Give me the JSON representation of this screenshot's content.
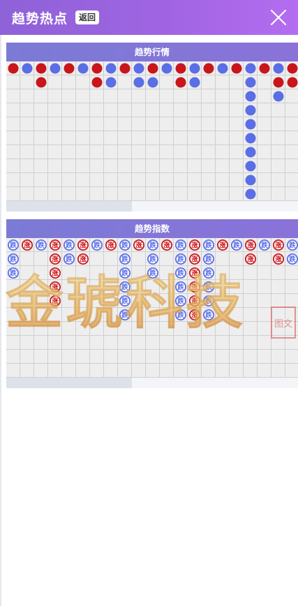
{
  "header": {
    "title": "趋势热点",
    "back_label": "返回",
    "close_icon": "close-icon"
  },
  "colors": {
    "header_start": "#8e62d8",
    "header_end": "#b46df0",
    "panel_title": "#7b7bd6",
    "red": "#c8161b",
    "blue": "#5a6ee6",
    "grid_bg": "#eeeeee",
    "grid_line": "#cfcfcf"
  },
  "panels": [
    {
      "title": "趋势行情",
      "type": "dots",
      "columns": [
        [
          "r"
        ],
        [
          "b"
        ],
        [
          "r",
          "r"
        ],
        [
          "b"
        ],
        [
          "r"
        ],
        [
          "b"
        ],
        [
          "r",
          "r"
        ],
        [
          "b",
          "b"
        ],
        [
          "r"
        ],
        [
          "b",
          "b"
        ],
        [
          "r",
          "b"
        ],
        [
          "b"
        ],
        [
          "r",
          "r"
        ],
        [
          "b",
          "b"
        ],
        [
          "r"
        ],
        [
          "b"
        ],
        [
          "r"
        ],
        [
          "b",
          "b",
          "b",
          "b",
          "b",
          "b",
          "b",
          "b",
          "b",
          "b"
        ],
        [
          "r"
        ],
        [
          "b",
          "r",
          "b"
        ],
        [
          "r",
          "r"
        ]
      ]
    },
    {
      "title": "趋势指数",
      "type": "badges",
      "up_label": "涨",
      "down_label": "跌",
      "columns": [
        [
          "d",
          "d",
          "d"
        ],
        [
          "u"
        ],
        [
          "d"
        ],
        [
          "u",
          "u",
          "u",
          "u",
          "u"
        ],
        [
          "d",
          "d"
        ],
        [
          "u",
          "u"
        ],
        [
          "d"
        ],
        [
          "u"
        ],
        [
          "d",
          "d",
          "d",
          "d",
          "d",
          "d"
        ],
        [
          "u"
        ],
        [
          "d",
          "d",
          "d"
        ],
        [
          "u"
        ],
        [
          "d",
          "d",
          "d",
          "d",
          "d",
          "d"
        ],
        [
          "u",
          "u",
          "u",
          "u",
          "u",
          "u"
        ],
        [
          "d",
          "d",
          "d",
          "d",
          "d",
          "d"
        ],
        [
          "u"
        ],
        [
          "d"
        ],
        [
          "u",
          "u"
        ],
        [
          "d"
        ],
        [
          "u",
          "u"
        ],
        [
          "d",
          "d"
        ]
      ]
    }
  ],
  "watermark": {
    "text": "金琥科技",
    "seal_text": "图文"
  }
}
